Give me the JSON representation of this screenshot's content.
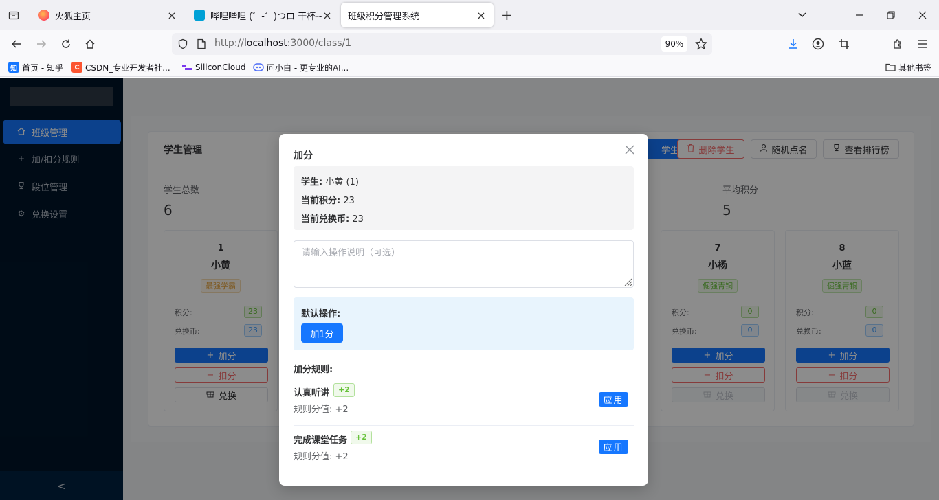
{
  "browser": {
    "tabs": [
      {
        "title": "火狐主页",
        "icon": "firefox-icon"
      },
      {
        "title": "哔哩哔哩 (゜-゜)つロ 干杯~-bilibili",
        "icon": "bilibili-icon"
      },
      {
        "title": "班级积分管理系统",
        "icon": "none",
        "active": true
      }
    ],
    "url_prefix": "http://",
    "url_host": "localhost",
    "url_rest": ":3000/class/1",
    "zoom": "90%",
    "bookmarks": [
      {
        "label": "首页 - 知乎",
        "icon_text": "知",
        "color": "#1677ff"
      },
      {
        "label": "CSDN_专业开发者社...",
        "icon_text": "C",
        "color": "#fc5531"
      },
      {
        "label": "SiliconCloud",
        "icon_text": "",
        "color": "#7c3aed"
      },
      {
        "label": "问小白 - 更专业的AI...",
        "icon_text": "",
        "color": "#4f6ef7"
      }
    ],
    "other_bookmarks": "其他书签"
  },
  "sidebar": {
    "items": [
      {
        "label": "班级管理",
        "icon": "home-icon",
        "active": true
      },
      {
        "label": "加/扣分规则",
        "icon": "plus-icon"
      },
      {
        "label": "段位管理",
        "icon": "trophy-icon"
      },
      {
        "label": "兑换设置",
        "icon": "gear-icon"
      }
    ],
    "collapse_glyph": "<"
  },
  "main": {
    "title": "学生管理",
    "buttons": {
      "add_student": "学生",
      "delete_student": "删除学生",
      "random_call": "随机点名",
      "ranking": "查看排行榜"
    },
    "stats": [
      {
        "label": "学生总数",
        "value": "6"
      },
      {
        "label": "平均积分",
        "value": "5"
      }
    ],
    "students": [
      {
        "id": "1",
        "name": "小黄",
        "tag": "最强学霸",
        "tag_color": "gold",
        "points": "23",
        "coins": "23",
        "exchange_enabled": true
      },
      {
        "id": "7",
        "name": "小杨",
        "tag": "倔强青铜",
        "tag_color": "green",
        "points": "0",
        "coins": "0",
        "exchange_enabled": false
      },
      {
        "id": "8",
        "name": "小蓝",
        "tag": "倔强青铜",
        "tag_color": "green",
        "points": "0",
        "coins": "0",
        "exchange_enabled": false
      }
    ],
    "card_labels": {
      "points": "积分:",
      "coins": "兑换币:",
      "add": "加分",
      "minus": "扣分",
      "exchange": "兑换"
    }
  },
  "modal": {
    "title": "加分",
    "student_label": "学生:",
    "student_value": "小黄 (1)",
    "points_label": "当前积分:",
    "points_value": "23",
    "coins_label": "当前兑换币:",
    "coins_value": "23",
    "description_placeholder": "请输入操作说明（可选）",
    "default_label": "默认操作:",
    "default_button": "加1分",
    "rules_title": "加分规则:",
    "rules": [
      {
        "name": "认真听讲",
        "badge": "+2",
        "value": "规则分值: +2",
        "apply": "应用"
      },
      {
        "name": "完成课堂任务",
        "badge": "+2",
        "value": "规则分值: +2",
        "apply": "应用"
      }
    ]
  }
}
